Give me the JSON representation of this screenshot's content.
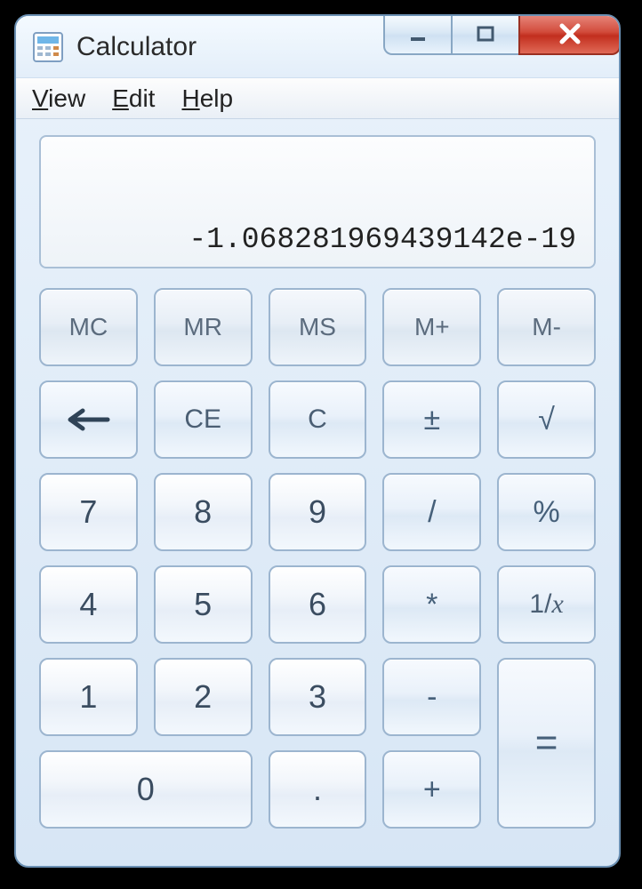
{
  "window": {
    "title": "Calculator"
  },
  "menu": {
    "view": "View",
    "edit": "Edit",
    "help": "Help"
  },
  "display": {
    "value": "-1.068281969439142e-19"
  },
  "buttons": {
    "mc": "MC",
    "mr": "MR",
    "ms": "MS",
    "mplus": "M+",
    "mminus": "M-",
    "ce": "CE",
    "c": "C",
    "plusminus": "±",
    "sqrt": "√",
    "n7": "7",
    "n8": "8",
    "n9": "9",
    "div": "/",
    "pct": "%",
    "n4": "4",
    "n5": "5",
    "n6": "6",
    "mul": "*",
    "recip_prefix": "1/",
    "recip_x": "x",
    "n1": "1",
    "n2": "2",
    "n3": "3",
    "sub": "-",
    "eq": "=",
    "n0": "0",
    "dot": ".",
    "add": "+"
  }
}
